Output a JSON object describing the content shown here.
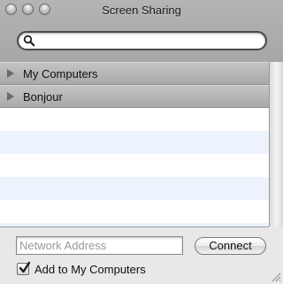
{
  "window": {
    "title": "Screen Sharing"
  },
  "search": {
    "placeholder": "",
    "value": ""
  },
  "groups": [
    {
      "label": "My Computers",
      "expanded": false
    },
    {
      "label": "Bonjour",
      "expanded": false
    }
  ],
  "address": {
    "placeholder": "Network Address",
    "value": ""
  },
  "connect": {
    "label": "Connect"
  },
  "add_to_my_computers": {
    "label": "Add to My Computers",
    "checked": true
  },
  "icons": {
    "search": "magnifier-icon",
    "disclosure": "disclosure-triangle-right-icon",
    "resize": "resize-grip-icon"
  },
  "colors": {
    "row_alternate": "#edf3fd",
    "group_header": "#b2b2b2",
    "toolbar": "#adadad"
  }
}
